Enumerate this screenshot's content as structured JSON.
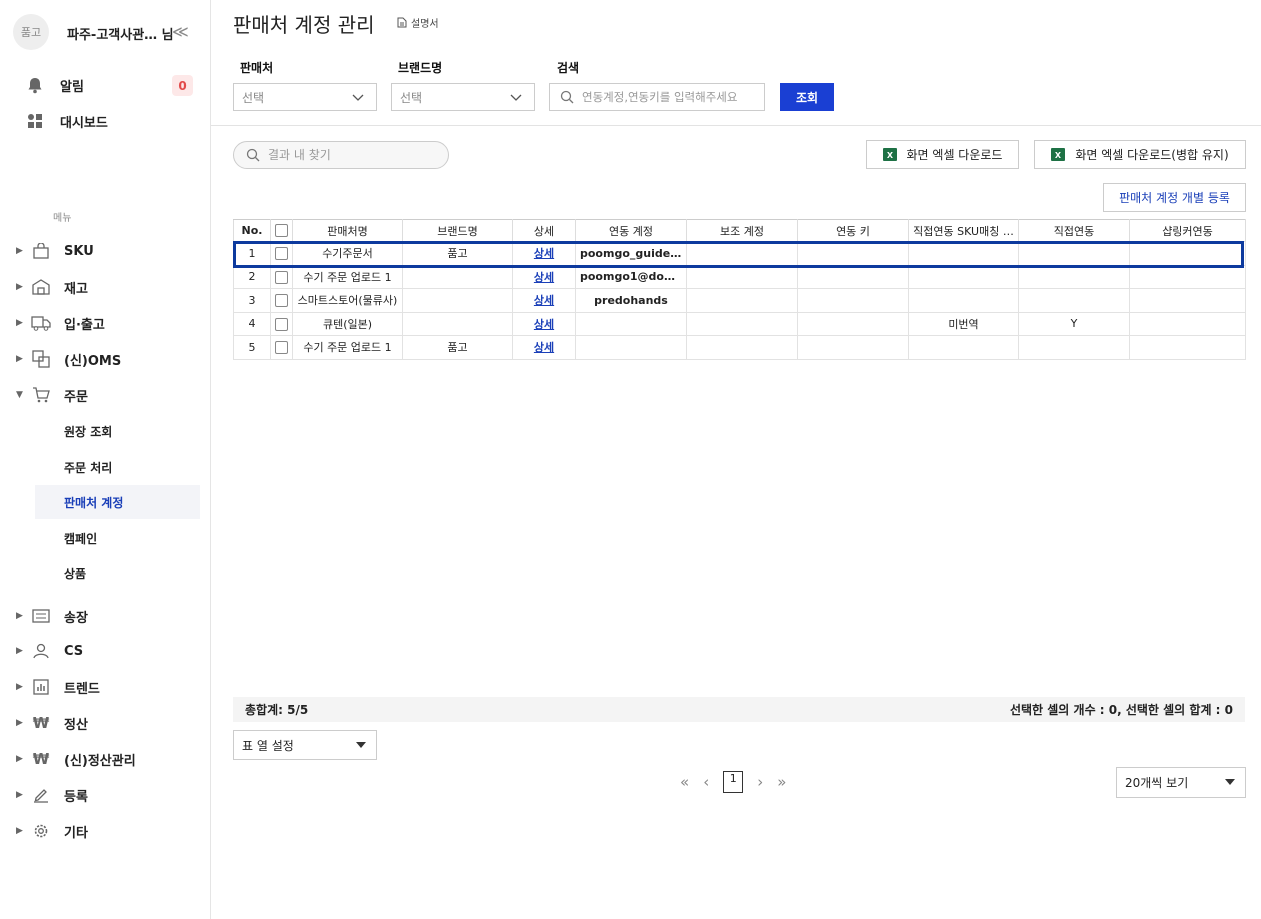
{
  "sidebar": {
    "avatar_text": "품고",
    "company": "파주-고객사관… 님",
    "collapse_glyph": "≪",
    "alerts_label": "알림",
    "alerts_count": "0",
    "dashboard_label": "대시보드",
    "menu_heading": "메뉴",
    "items": [
      {
        "label": "SKU"
      },
      {
        "label": "재고"
      },
      {
        "label": "입·출고"
      },
      {
        "label": "(신)OMS"
      },
      {
        "label": "주문"
      },
      {
        "label": "송장"
      },
      {
        "label": "CS"
      },
      {
        "label": "트렌드"
      },
      {
        "label": "정산"
      },
      {
        "label": "(신)정산관리"
      },
      {
        "label": "등록"
      },
      {
        "label": "기타"
      }
    ],
    "order_sub": [
      {
        "label": "원장 조회"
      },
      {
        "label": "주문 처리"
      },
      {
        "label": "판매처 계정"
      },
      {
        "label": "캠페인"
      },
      {
        "label": "상품"
      }
    ]
  },
  "header": {
    "title": "판매처 계정 관리",
    "manual": "설명서"
  },
  "filters": {
    "seller_label": "판매처",
    "seller_value": "선택",
    "brand_label": "브랜드명",
    "brand_value": "선택",
    "search_label": "검색",
    "search_placeholder": "연동계정,연동키를 입력해주세요",
    "search_button": "조회"
  },
  "toolbar": {
    "find_placeholder": "결과 내 찾기",
    "excel_download": "화면 엑셀 다운로드",
    "excel_download_merged": "화면 엑셀 다운로드(병합 유지)",
    "register_button": "판매처 계정 개별 등록"
  },
  "table": {
    "headers": [
      "No.",
      "",
      "판매처명",
      "브랜드명",
      "상세",
      "연동 계정",
      "보조 계정",
      "연동 키",
      "직접연동 SKU매칭 …",
      "직접연동",
      "샵링커연동"
    ],
    "rows": [
      {
        "no": "1",
        "seller": "수기주문서",
        "brand": "품고",
        "detail": "상세",
        "account": "poomgo_guide@…",
        "sub": "",
        "key": "",
        "sku": "",
        "direct": "",
        "shoplinker": ""
      },
      {
        "no": "2",
        "seller": "수기 주문 업로드 1",
        "brand": "",
        "detail": "상세",
        "account": "poomgo1@doha…",
        "sub": "",
        "key": "",
        "sku": "",
        "direct": "",
        "shoplinker": ""
      },
      {
        "no": "3",
        "seller": "스마트스토어(물류사)",
        "brand": "",
        "detail": "상세",
        "account": "predohands",
        "sub": "",
        "key": "",
        "sku": "",
        "direct": "",
        "shoplinker": ""
      },
      {
        "no": "4",
        "seller": "큐텐(일본)",
        "brand": "",
        "detail": "상세",
        "account": "",
        "sub": "",
        "key": "",
        "sku": "미번역",
        "direct": "Y",
        "shoplinker": ""
      },
      {
        "no": "5",
        "seller": "수기 주문 업로드 1",
        "brand": "품고",
        "detail": "상세",
        "account": "",
        "sub": "",
        "key": "",
        "sku": "",
        "direct": "",
        "shoplinker": ""
      }
    ]
  },
  "footer": {
    "total": "총합계: 5/5",
    "selection": "선택한 셀의 개수 : 0, 선택한 셀의 합계 : 0",
    "column_settings": "표 열 설정",
    "current_page": "1",
    "page_size": "20개씩 보기"
  },
  "colors": {
    "primary": "#1a3fd3",
    "highlight_border": "#0d3a9e",
    "badge_bg": "#fde8e8",
    "badge_text": "#e24a4a",
    "excel_green": "#1e7145"
  }
}
